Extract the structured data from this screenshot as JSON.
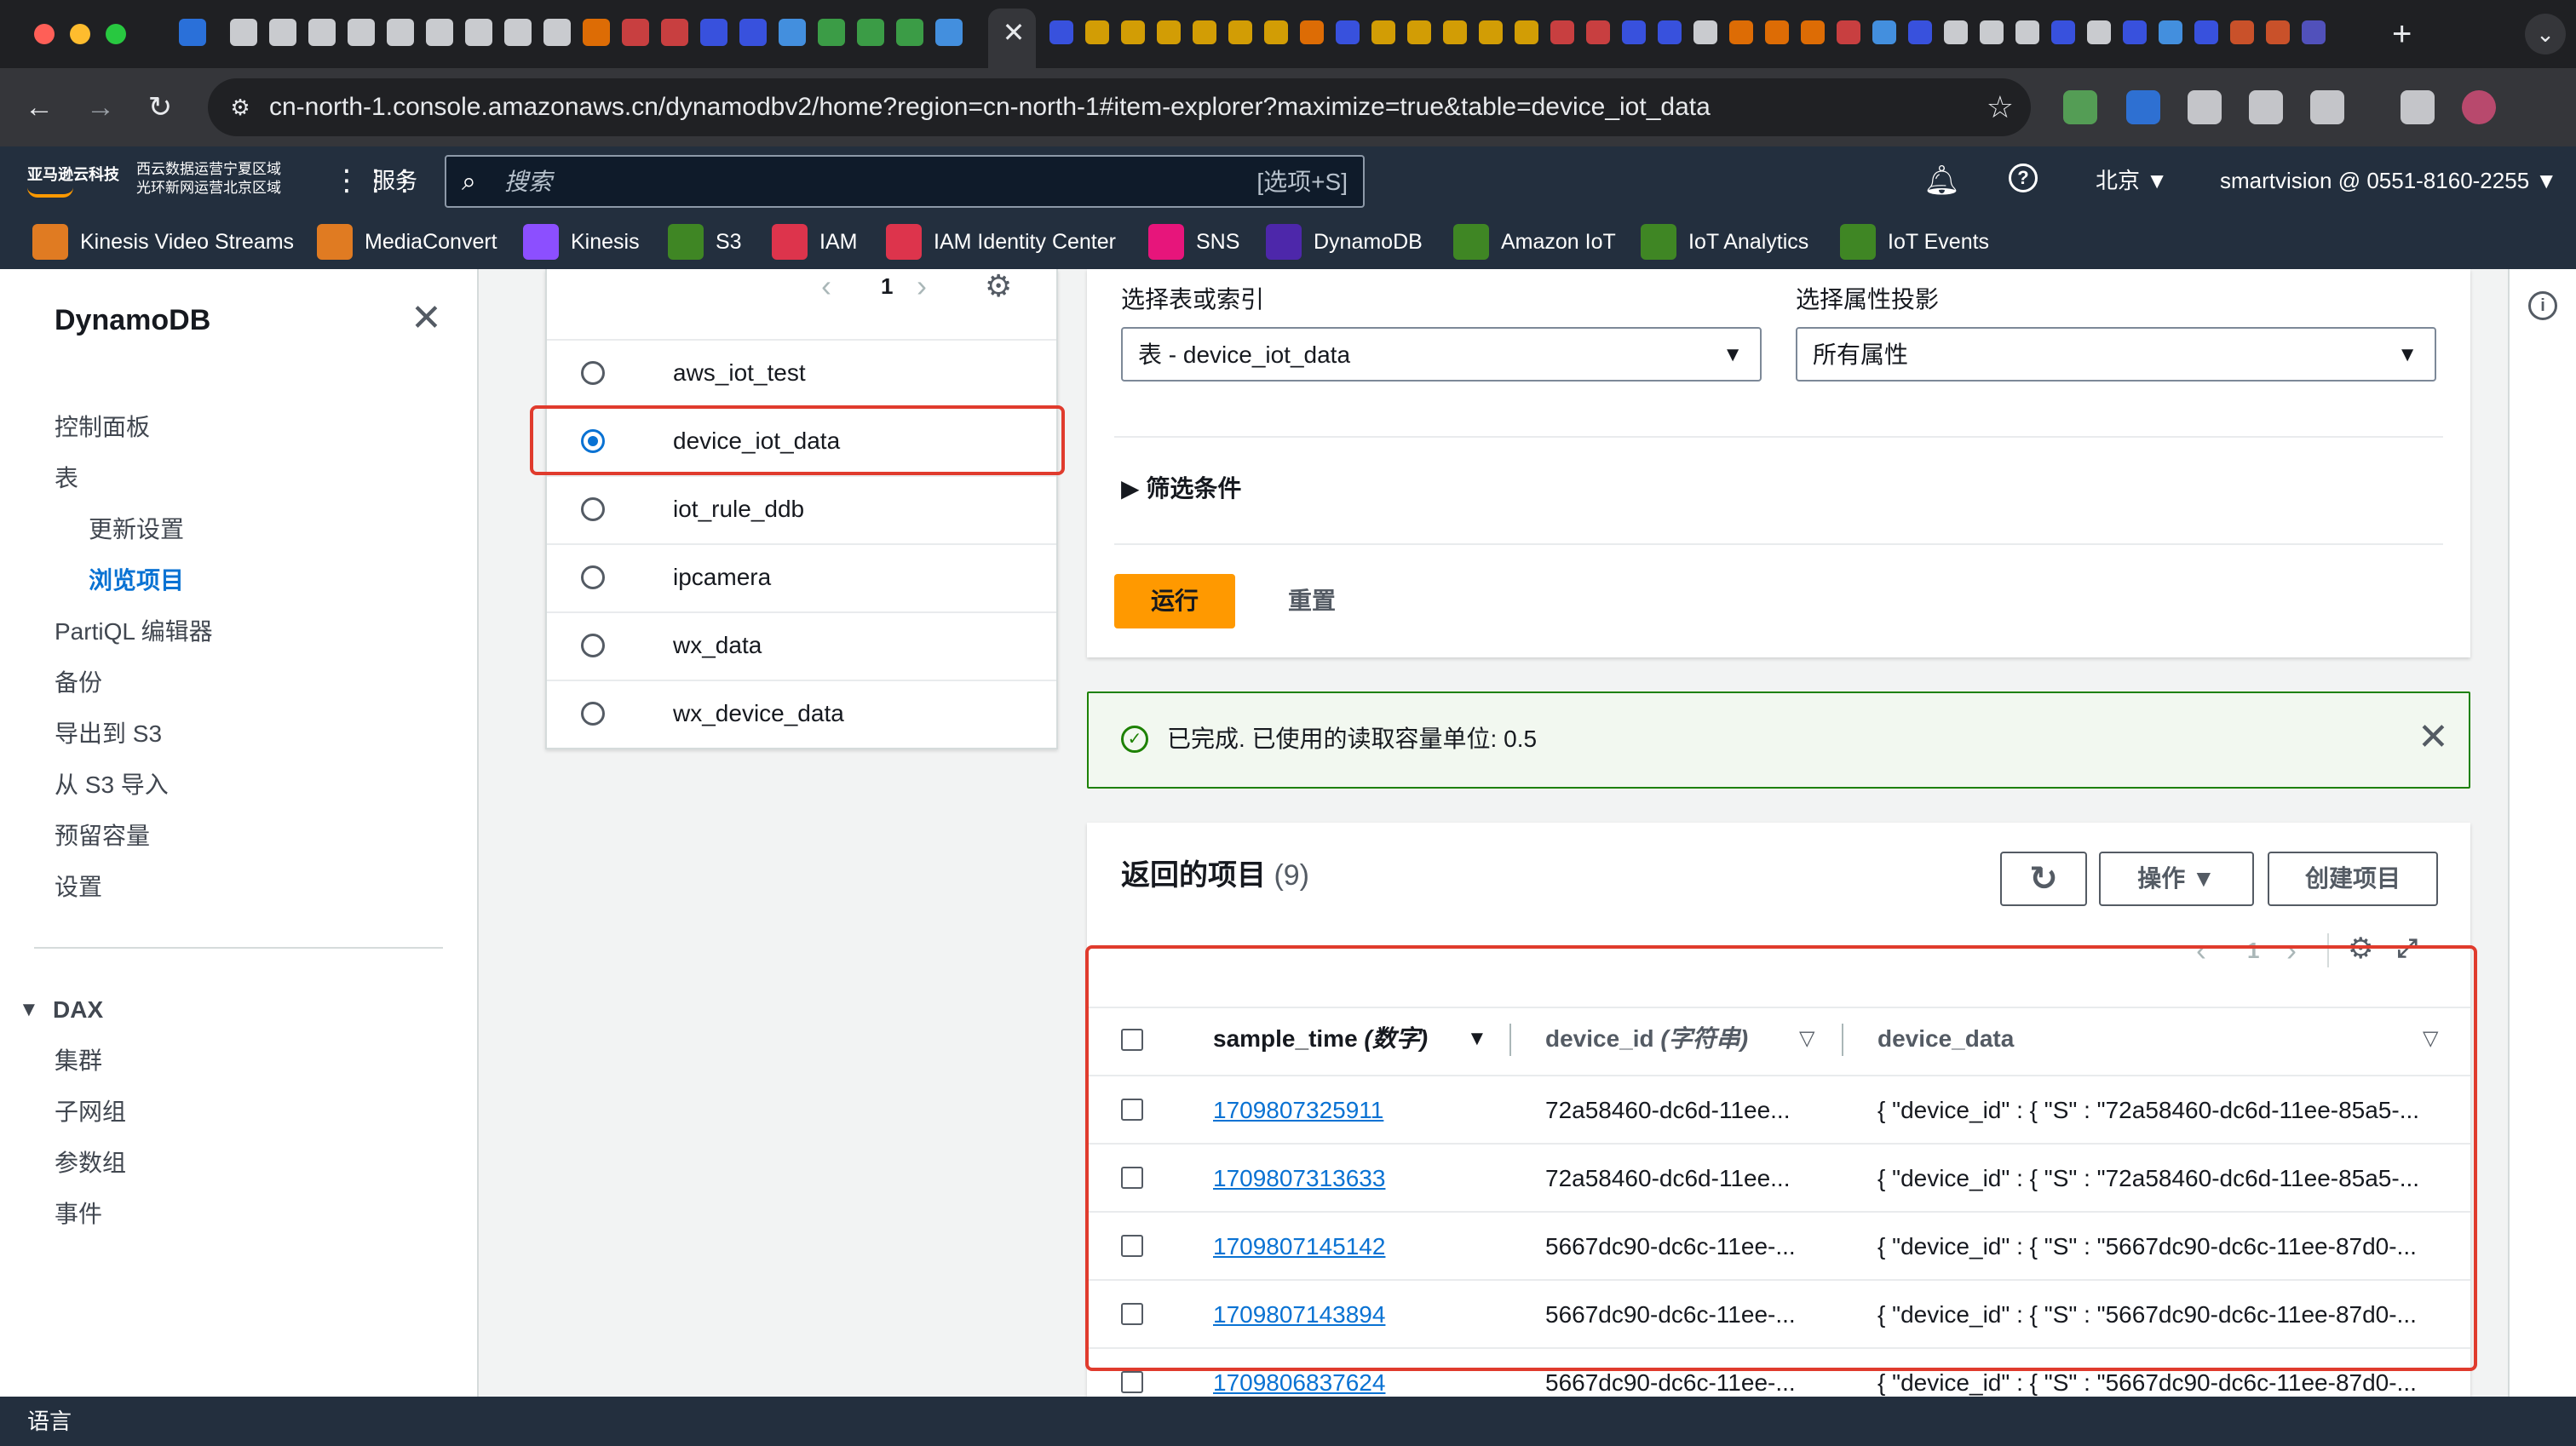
{
  "browser": {
    "url": "cn-north-1.console.amazonaws.cn/dynamodbv2/home?region=cn-north-1#item-explorer?maximize=true&table=device_iot_data",
    "tab_close": "✕",
    "new_tab": "+",
    "tab_menu": "⌄",
    "back": "←",
    "forward": "→",
    "reload": "↻",
    "site_info": "⚙",
    "star": "☆",
    "tab_icon_colors": [
      "#2d7ff9",
      "#e8eaed",
      "#e8eaed",
      "#e8eaed",
      "#e8eaed",
      "#e8eaed",
      "#e8eaed",
      "#e8eaed",
      "#e8eaed",
      "#e8eaed",
      "#ff7a00",
      "#e64545",
      "#e64545",
      "#3d5afe",
      "#3d5afe",
      "#4aa3ff",
      "#41b34c",
      "#41b34c",
      "#41b34c",
      "#4aa3ff"
    ],
    "tab_icon_colors_right": [
      "#3d5afe",
      "#f2b400",
      "#f2b400",
      "#f2b400",
      "#f2b400",
      "#f2b400",
      "#f2b400",
      "#ff7a00",
      "#3d5afe",
      "#f2b400",
      "#f2b400",
      "#f2b400",
      "#f2b400",
      "#f2b400",
      "#e64545",
      "#e64545",
      "#3d5afe",
      "#3d5afe",
      "#e8eaed",
      "#ff7a00",
      "#ff7a00",
      "#ff7a00",
      "#e64545",
      "#4aa3ff",
      "#3d5afe",
      "#e8eaed",
      "#e8eaed",
      "#e8eaed",
      "#3d5afe",
      "#e8eaed",
      "#3d5afe",
      "#4aa3ff",
      "#3d5afe",
      "#e85a2c",
      "#e85a2c",
      "#5b5bd6"
    ],
    "ext_icon_colors": [
      "#5cb85c",
      "#2d7ff9",
      "#e8eaed",
      "#e8eaed",
      "#e8eaed",
      "#e8eaed",
      "#d94f7a"
    ]
  },
  "aws": {
    "logo_text": "亚马逊云科技",
    "region_info_line1": "西云数据运营宁夏区域",
    "region_info_line2": "光环新网运营北京区域",
    "services_label": "服务",
    "search_placeholder": "搜索",
    "search_shortcut": "[选项+S]",
    "region": "北京 ▼",
    "account": "smartvision @ 0551-8160-2255 ▼",
    "favorites": [
      {
        "label": "Kinesis Video Streams",
        "color": "#e07b22"
      },
      {
        "label": "MediaConvert",
        "color": "#e07b22"
      },
      {
        "label": "Kinesis",
        "color": "#8c4fff"
      },
      {
        "label": "S3",
        "color": "#3f8624"
      },
      {
        "label": "IAM",
        "color": "#dd344c"
      },
      {
        "label": "IAM Identity Center",
        "color": "#dd344c"
      },
      {
        "label": "SNS",
        "color": "#e7157b"
      },
      {
        "label": "DynamoDB",
        "color": "#4d27aa"
      },
      {
        "label": "Amazon IoT",
        "color": "#3f8624"
      },
      {
        "label": "IoT Analytics",
        "color": "#3f8624"
      },
      {
        "label": "IoT Events",
        "color": "#3f8624"
      }
    ]
  },
  "nav": {
    "title": "DynamoDB",
    "close": "✕",
    "items": [
      "控制面板",
      "表",
      "更新设置",
      "浏览项目",
      "PartiQL 编辑器",
      "备份",
      "导出到 S3",
      "从 S3 导入",
      "预留容量",
      "设置"
    ],
    "dax_title": "DAX",
    "dax_items": [
      "集群",
      "子网组",
      "参数组",
      "事件"
    ]
  },
  "table_list": {
    "page": "1",
    "tables": [
      "aws_iot_test",
      "device_iot_data",
      "iot_rule_ddb",
      "ipcamera",
      "wx_data",
      "wx_device_data"
    ],
    "selected_index": 1
  },
  "query": {
    "table_label": "选择表或索引",
    "table_value": "表 - device_iot_data",
    "projection_label": "选择属性投影",
    "projection_value": "所有属性",
    "filter_label": "筛选条件",
    "run_label": "运行",
    "reset_label": "重置"
  },
  "alert": {
    "text": "已完成. 已使用的读取容量单位: 0.5"
  },
  "results": {
    "title": "返回的项目",
    "count": "(9)",
    "actions_label": "操作 ▼",
    "create_label": "创建项目",
    "page": "1",
    "columns": [
      {
        "name": "sample_time",
        "type": "(数字)"
      },
      {
        "name": "device_id",
        "type": "(字符串)"
      },
      {
        "name": "device_data",
        "type": ""
      }
    ],
    "rows": [
      {
        "sample_time": "1709807325911",
        "device_id": "72a58460-dc6d-11ee...",
        "device_data": "{ \"device_id\" : { \"S\" : \"72a58460-dc6d-11ee-85a5-..."
      },
      {
        "sample_time": "1709807313633",
        "device_id": "72a58460-dc6d-11ee...",
        "device_data": "{ \"device_id\" : { \"S\" : \"72a58460-dc6d-11ee-85a5-..."
      },
      {
        "sample_time": "1709807145142",
        "device_id": "5667dc90-dc6c-11ee-...",
        "device_data": "{ \"device_id\" : { \"S\" : \"5667dc90-dc6c-11ee-87d0-..."
      },
      {
        "sample_time": "1709807143894",
        "device_id": "5667dc90-dc6c-11ee-...",
        "device_data": "{ \"device_id\" : { \"S\" : \"5667dc90-dc6c-11ee-87d0-..."
      },
      {
        "sample_time": "1709806837624",
        "device_id": "5667dc90-dc6c-11ee-...",
        "device_data": "{ \"device_id\" : { \"S\" : \"5667dc90-dc6c-11ee-87d0-..."
      }
    ]
  },
  "footer": {
    "language": "语言"
  }
}
